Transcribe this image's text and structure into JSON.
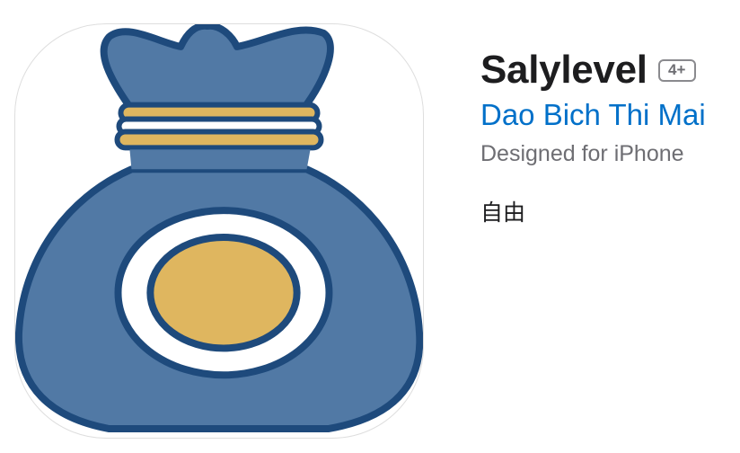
{
  "app": {
    "title": "Salylevel",
    "age_rating": "4+",
    "developer": "Dao Bich Thi Mai",
    "platform": "Designed for iPhone",
    "price": "自由"
  },
  "icon": {
    "name": "money-bag-icon",
    "colors": {
      "bag_fill": "#5179a5",
      "outline": "#1e4a7c",
      "gold": "#dfb65f",
      "white": "#ffffff"
    }
  }
}
